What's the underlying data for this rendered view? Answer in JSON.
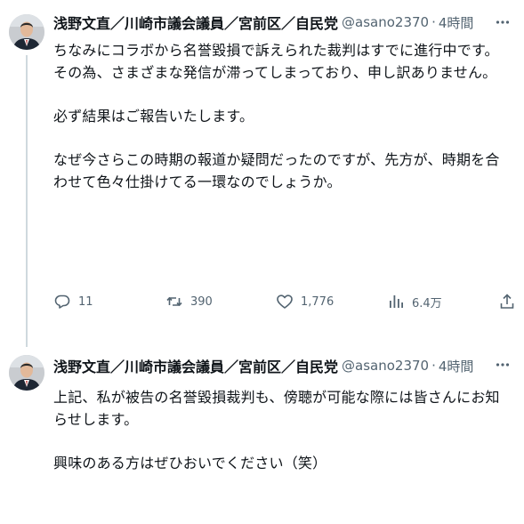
{
  "tweets": [
    {
      "author": {
        "display_name": "浅野文直／川崎市議会議員／宮前区／自民党",
        "handle": "@asano2370",
        "separator": "·",
        "time": "4時間"
      },
      "paragraphs": [
        "ちなみにコラボから名誉毀損で訴えられた裁判はすでに進行中です。その為、さまざまな発信が滞ってしまっており、申し訳ありません。",
        "必ず結果はご報告いたします。",
        "なぜ今さらこの時期の報道か疑問だったのですが、先方が、時期を合わせて色々仕掛けてる一環なのでしょうか。"
      ],
      "stats": {
        "replies": "11",
        "retweets": "390",
        "likes": "1,776",
        "views": "6.4万"
      }
    },
    {
      "author": {
        "display_name": "浅野文直／川崎市議会議員／宮前区／自民党",
        "handle": "@asano2370",
        "separator": "·",
        "time": "4時間"
      },
      "paragraphs": [
        "上記、私が被告の名誉毀損裁判も、傍聴が可能な際には皆さんにお知らせします。",
        "興味のある方はぜひおいでください（笑）"
      ]
    }
  ],
  "icons": {
    "reply": "reply-icon",
    "retweet": "retweet-icon",
    "like": "heart-icon",
    "views": "views-chart-icon",
    "share": "share-icon",
    "more": "more-dots-icon"
  },
  "colors": {
    "text_primary": "#0f1419",
    "text_secondary": "#536471",
    "thread_line": "#cfd9de",
    "background": "#ffffff"
  }
}
